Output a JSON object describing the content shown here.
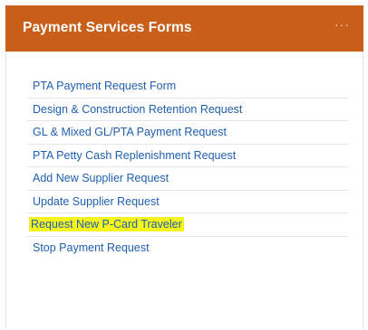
{
  "card": {
    "title": "Payment Services Forms",
    "menu_label": "···",
    "header_color": "#c8601b",
    "link_color": "#1f5fb0",
    "highlight_color": "#f6f51b"
  },
  "links": [
    {
      "label": "PTA Payment Request Form",
      "highlighted": false
    },
    {
      "label": "Design & Construction Retention Request",
      "highlighted": false
    },
    {
      "label": "GL & Mixed GL/PTA Payment Request",
      "highlighted": false
    },
    {
      "label": "PTA Petty Cash Replenishment Request",
      "highlighted": false
    },
    {
      "label": "Add New Supplier Request",
      "highlighted": false
    },
    {
      "label": "Update Supplier Request",
      "highlighted": false
    },
    {
      "label": "Request New P-Card Traveler",
      "highlighted": true
    },
    {
      "label": "Stop Payment Request",
      "highlighted": false
    }
  ]
}
